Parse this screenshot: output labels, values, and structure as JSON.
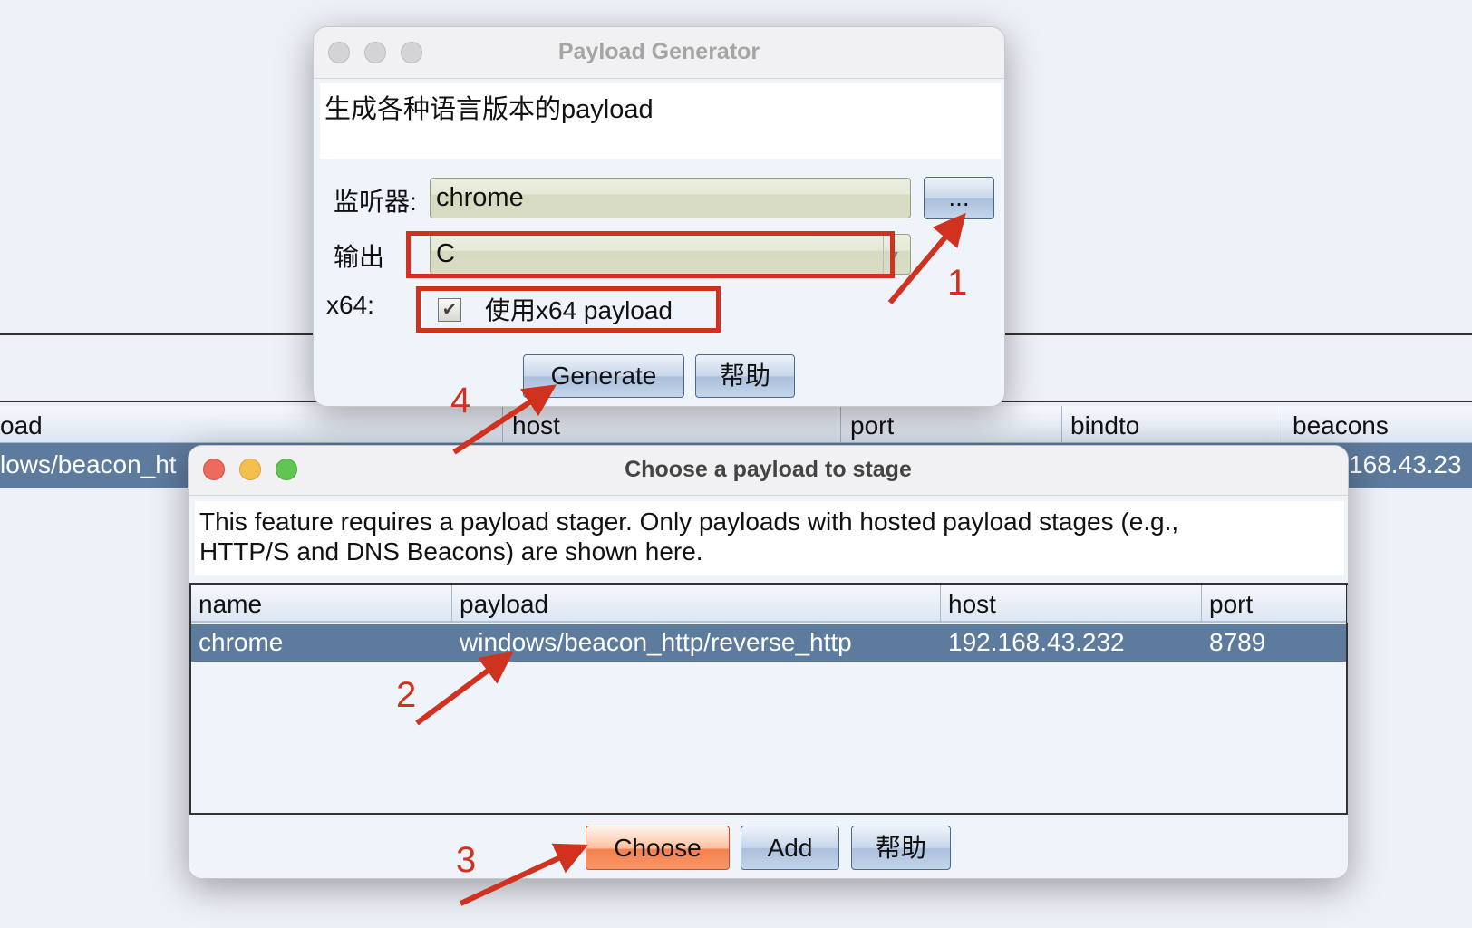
{
  "background_table": {
    "headers": [
      "oad",
      "host",
      "port",
      "bindto",
      "beacons"
    ],
    "row": {
      "payload": "lows/beacon_ht",
      "host_partial": "168.43.23"
    }
  },
  "payload_generator": {
    "title": "Payload Generator",
    "description": "生成各种语言版本的payload",
    "listener_label": "监听器:",
    "listener_value": "chrome",
    "browse_label": "...",
    "output_label": "输出",
    "output_value": "C",
    "x64_label": "x64:",
    "x64_checkbox_label": "使用x64 payload",
    "x64_checked": true,
    "generate_label": "Generate",
    "help_label": "帮助"
  },
  "stage_dialog": {
    "title": "Choose a payload to stage",
    "description_line1": "This feature requires a payload stager. Only payloads with hosted payload stages (e.g.,",
    "description_line2": "HTTP/S and DNS Beacons) are shown here.",
    "columns": [
      "name",
      "payload",
      "host",
      "port"
    ],
    "rows": [
      {
        "name": "chrome",
        "payload": "windows/beacon_http/reverse_http",
        "host": "192.168.43.232",
        "port": "8789",
        "selected": true
      }
    ],
    "choose_label": "Choose",
    "add_label": "Add",
    "help_label": "帮助"
  },
  "annotations": {
    "step1": "1",
    "step2": "2",
    "step3": "3",
    "step4": "4",
    "color": "#d0321f"
  },
  "colors": {
    "selection": "#5d7b9d",
    "accent_button": "#f5804e"
  }
}
